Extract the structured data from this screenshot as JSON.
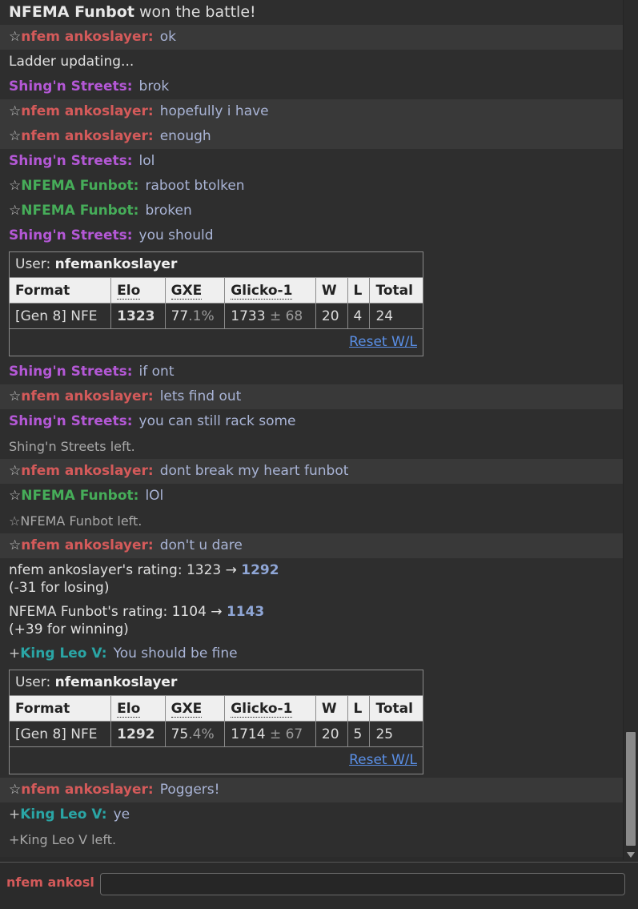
{
  "log": {
    "winner_name": "NFEMA Funbot",
    "winner_suffix": "won the battle!",
    "messages_a": [
      {
        "sym": "☆",
        "user": "nfem ankoslayer:",
        "text": "ok",
        "color": "#d45a5a"
      }
    ],
    "ladder_updating": "Ladder updating...",
    "messages_b": [
      {
        "sym": "",
        "user": "Shing'n Streets:",
        "text": "brok"
      },
      {
        "sym": "☆",
        "user": "nfem ankoslayer:",
        "text": "hopefully i have"
      },
      {
        "sym": "☆",
        "user": "nfem ankoslayer:",
        "text": "enough"
      },
      {
        "sym": "",
        "user": "Shing'n Streets:",
        "text": "lol"
      },
      {
        "sym": "☆",
        "user": "NFEMA Funbot:",
        "text": "raboot btolken"
      },
      {
        "sym": "☆",
        "user": "NFEMA Funbot:",
        "text": "broken"
      },
      {
        "sym": "",
        "user": "Shing'n Streets:",
        "text": "you should"
      }
    ],
    "ladder1": {
      "user_label": "User:",
      "user_name": "nfemankoslayer",
      "headers": [
        "Format",
        "Elo",
        "GXE",
        "Glicko-1",
        "W",
        "L",
        "Total"
      ],
      "format": "[Gen 8] NFE",
      "elo": "1323",
      "gxe_main": "77",
      "gxe_dec": ".1%",
      "glicko": "1733",
      "glicko_dev": "± 68",
      "w": "20",
      "l": "4",
      "total": "24",
      "reset": "Reset W/L"
    },
    "messages_c": [
      {
        "sym": "",
        "user": "Shing'n Streets:",
        "text": "if ont"
      },
      {
        "sym": "☆",
        "user": "nfem ankoslayer:",
        "text": "lets find out"
      },
      {
        "sym": "",
        "user": "Shing'n Streets:",
        "text": "you can still rack some"
      }
    ],
    "leave1": "Shing'n Streets left.",
    "messages_d": [
      {
        "sym": "☆",
        "user": "nfem ankoslayer:",
        "text": "dont break my heart funbot"
      },
      {
        "sym": "☆",
        "user": "NFEMA Funbot:",
        "text": "lOl"
      }
    ],
    "leave2": "☆NFEMA Funbot left.",
    "messages_e": [
      {
        "sym": "☆",
        "user": "nfem ankoslayer:",
        "text": "don't u dare"
      }
    ],
    "rating1_line": "nfem ankoslayer's rating: 1323 →",
    "rating1_new": "1292",
    "rating1_note": "(-31 for losing)",
    "rating2_line": "NFEMA Funbot's rating: 1104 →",
    "rating2_new": "1143",
    "rating2_note": "(+39 for winning)",
    "messages_f": [
      {
        "sym": "+",
        "user": "King Leo V:",
        "text": "You should be fine"
      }
    ],
    "ladder2": {
      "user_label": "User:",
      "user_name": "nfemankoslayer",
      "headers": [
        "Format",
        "Elo",
        "GXE",
        "Glicko-1",
        "W",
        "L",
        "Total"
      ],
      "format": "[Gen 8] NFE",
      "elo": "1292",
      "gxe_main": "75",
      "gxe_dec": ".4%",
      "glicko": "1714",
      "glicko_dev": "± 67",
      "w": "20",
      "l": "5",
      "total": "25",
      "reset": "Reset W/L"
    },
    "messages_g": [
      {
        "sym": "☆",
        "user": "nfem ankoslayer:",
        "text": "Poggers!"
      },
      {
        "sym": "+",
        "user": "King Leo V:",
        "text": "ye"
      }
    ],
    "leave3": "+King Leo V left."
  },
  "composer": {
    "user_name": "nfem ankosl",
    "input_value": "",
    "input_placeholder": ""
  },
  "colors": {
    "nfem": "#d45a5a",
    "shing": "#b458d6",
    "funbot": "#46ad59",
    "kingleo": "#2aa5a5",
    "message": "#a9b4d6",
    "link": "#5a8fe6"
  }
}
